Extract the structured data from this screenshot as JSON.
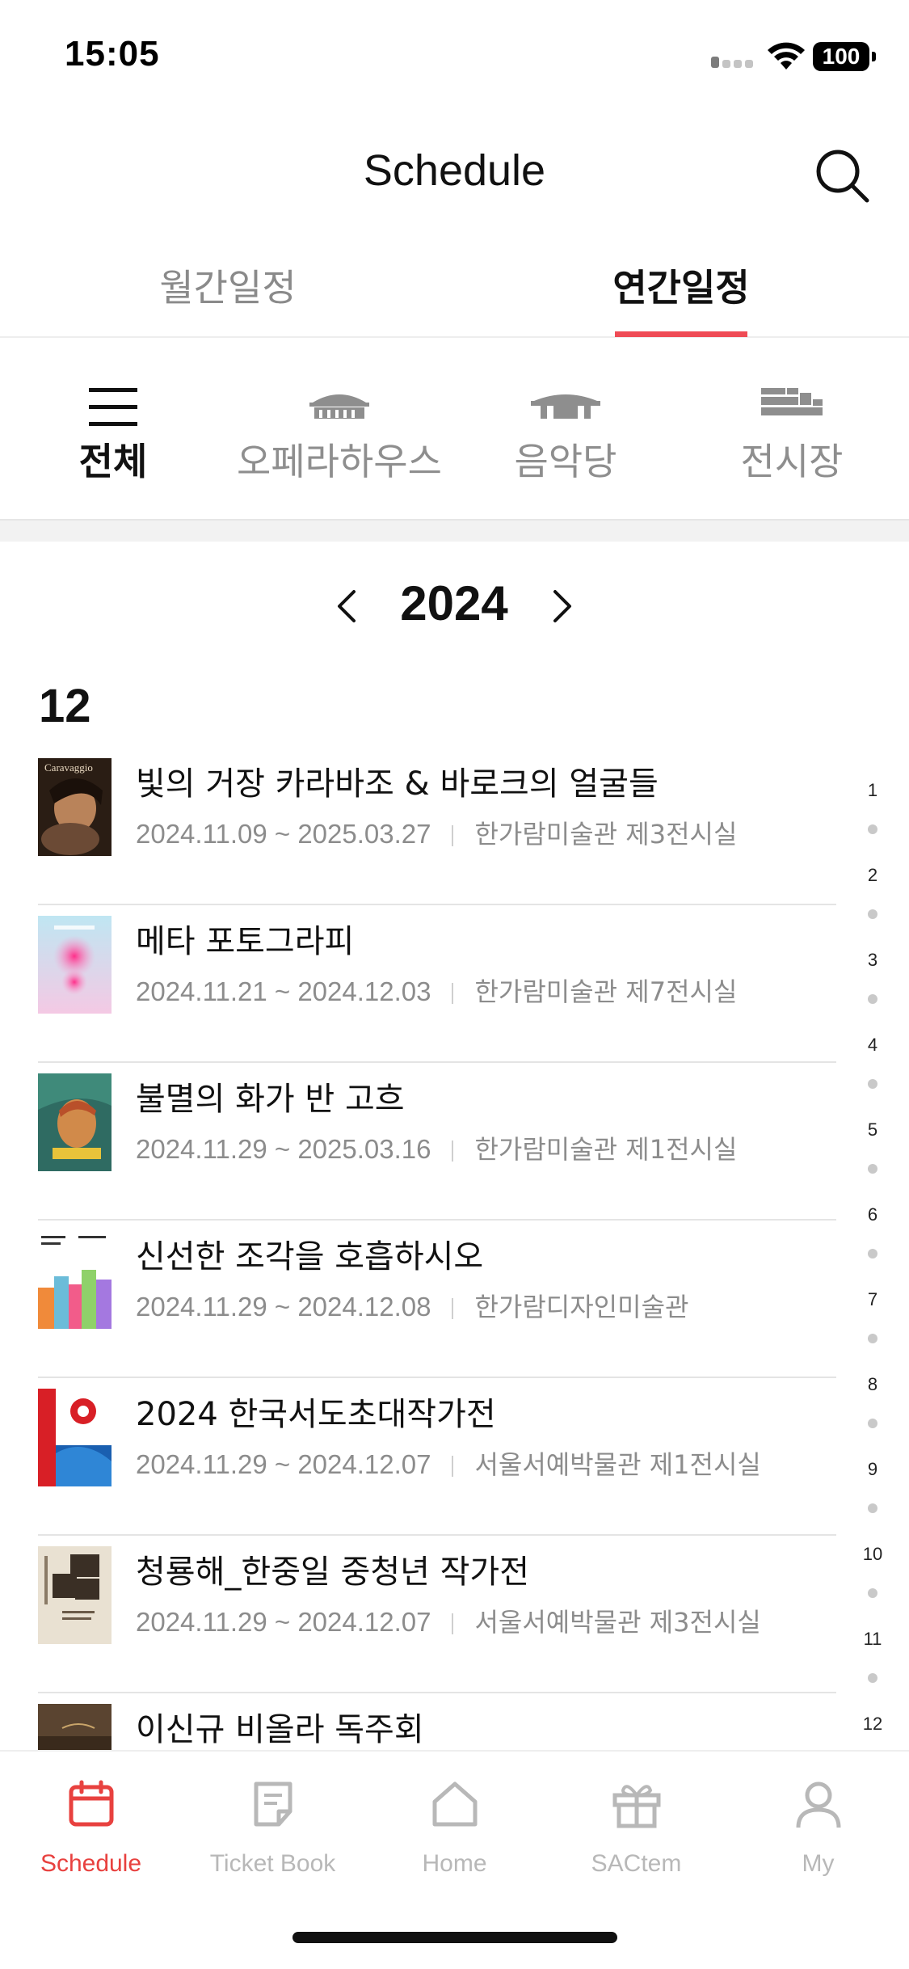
{
  "status_bar": {
    "time": "15:05",
    "battery": "100"
  },
  "header": {
    "title": "Schedule",
    "search_icon": "search-icon"
  },
  "tabs": [
    {
      "label": "월간일정",
      "active": false
    },
    {
      "label": "연간일정",
      "active": true
    }
  ],
  "venues": [
    {
      "label": "전체",
      "icon": "menu-icon",
      "active": true
    },
    {
      "label": "오페라하우스",
      "icon": "opera-house-icon",
      "active": false
    },
    {
      "label": "음악당",
      "icon": "concert-hall-icon",
      "active": false
    },
    {
      "label": "전시장",
      "icon": "exhibition-hall-icon",
      "active": false
    }
  ],
  "year_nav": {
    "year": "2024"
  },
  "month": "12",
  "events": [
    {
      "title": "빛의 거장 카라바조 & 바로크의 얼굴들",
      "dates": "2024.11.09 ~ 2025.03.27",
      "venue": "한가람미술관 제3전시실",
      "thumb_text": "Caravaggio"
    },
    {
      "title": "메타 포토그라피",
      "dates": "2024.11.21 ~ 2024.12.03",
      "venue": "한가람미술관 제7전시실"
    },
    {
      "title": "불멸의 화가 반 고흐",
      "dates": "2024.11.29 ~ 2025.03.16",
      "venue": "한가람미술관 제1전시실"
    },
    {
      "title": "신선한 조각을 호흡하시오",
      "dates": "2024.11.29 ~ 2024.12.08",
      "venue": "한가람디자인미술관"
    },
    {
      "title": "2024 한국서도초대작가전",
      "dates": "2024.11.29 ~ 2024.12.07",
      "venue": "서울서예박물관 제1전시실"
    },
    {
      "title": "청룡해_한중일 중청년 작가전",
      "dates": "2024.11.29 ~ 2024.12.07",
      "venue": "서울서예박물관 제3전시실"
    },
    {
      "title": "이신규 비올라 독주회",
      "dates": "",
      "venue": ""
    }
  ],
  "month_index": [
    "1",
    "2",
    "3",
    "4",
    "5",
    "6",
    "7",
    "8",
    "9",
    "10",
    "11",
    "12"
  ],
  "bottom_nav": [
    {
      "label": "Schedule",
      "icon": "calendar-icon",
      "active": true
    },
    {
      "label": "Ticket Book",
      "icon": "ticket-book-icon",
      "active": false
    },
    {
      "label": "Home",
      "icon": "home-icon",
      "active": false
    },
    {
      "label": "SACtem",
      "icon": "gift-icon",
      "active": false
    },
    {
      "label": "My",
      "icon": "user-icon",
      "active": false
    }
  ],
  "colors": {
    "accent": "#e8413f",
    "tab_underline": "#ef4b55",
    "muted_text": "#8c8c8c"
  }
}
